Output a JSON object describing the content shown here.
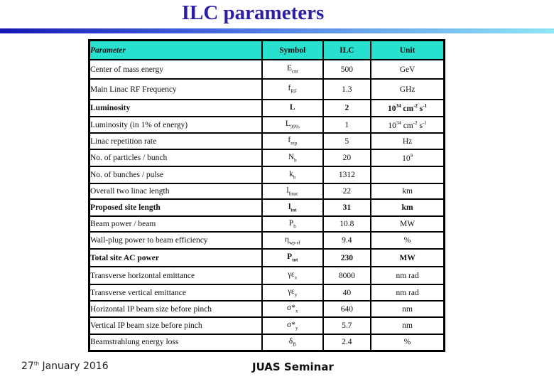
{
  "title": "ILC parameters",
  "table": {
    "headers": {
      "parameter": "Parameter",
      "symbol": "Symbol",
      "ilc": "ILC",
      "unit": "Unit"
    },
    "rows": [
      {
        "parameter": "Center of mass energy",
        "symbol": "E",
        "symbol_sub": "cm",
        "value": "500",
        "unit": "GeV",
        "unit_sup1": "",
        "unit_mid": "",
        "unit_sup2": "",
        "unit_end": "",
        "unit_sup3": "",
        "bold": false
      },
      {
        "parameter": "Main Linac RF Frequency",
        "symbol": "f",
        "symbol_sub": "RF",
        "value": "1.3",
        "unit": "GHz",
        "bold": false
      },
      {
        "parameter": "Luminosity",
        "symbol": "L",
        "symbol_sub": "",
        "value": "2",
        "unit": "10",
        "unit_sup1": "34",
        "unit_mid": " cm",
        "unit_sup2": "-2",
        "unit_end": " s",
        "unit_sup3": "-1",
        "bold": true
      },
      {
        "parameter": "Luminosity (in 1% of energy)",
        "symbol": "L",
        "symbol_sub": "99%",
        "value": "1",
        "unit": "10",
        "unit_sup1": "34",
        "unit_mid": " cm",
        "unit_sup2": "-2",
        "unit_end": " s",
        "unit_sup3": "-1",
        "bold": false
      },
      {
        "parameter": "Linac repetition rate",
        "symbol": "f",
        "symbol_sub": "rep",
        "value": "5",
        "unit": "Hz",
        "bold": false
      },
      {
        "parameter": "No. of particles / bunch",
        "symbol": "N",
        "symbol_sub": "b",
        "value": "20",
        "unit": "10",
        "unit_sup1": "9",
        "bold": false
      },
      {
        "parameter": "No. of bunches / pulse",
        "symbol": "k",
        "symbol_sub": "b",
        "value": "1312",
        "unit": "",
        "bold": false
      },
      {
        "parameter": "Overall two linac length",
        "symbol": "l",
        "symbol_sub": "linac",
        "value": "22",
        "unit": "km",
        "bold": false
      },
      {
        "parameter": "Proposed site length",
        "symbol": "l",
        "symbol_sub": "tot",
        "value": "31",
        "unit": "km",
        "bold": true
      },
      {
        "parameter": "Beam power / beam",
        "symbol": "P",
        "symbol_sub": "b",
        "value": "10.8",
        "unit": "MW",
        "bold": false
      },
      {
        "parameter": "Wall-plug power to beam efficiency",
        "symbol": "η",
        "symbol_sub": "wp-rf",
        "value": "9.4",
        "unit": "%",
        "bold": false
      },
      {
        "parameter": "Total site AC power",
        "symbol": "P",
        "symbol_sub": "tot",
        "value": "230",
        "unit": "MW",
        "bold": true
      },
      {
        "parameter": "Transverse horizontal emittance",
        "symbol": "γε",
        "symbol_sub": "x",
        "value": "8000",
        "unit": "nm rad",
        "bold": false
      },
      {
        "parameter": "Transverse vertical emittance",
        "symbol": "γε",
        "symbol_sub": "y",
        "value": "40",
        "unit": "nm rad",
        "bold": false
      },
      {
        "parameter": "Horizontal IP beam size before pinch",
        "symbol": "σ*",
        "symbol_sub": "x",
        "value": "640",
        "unit": "nm",
        "bold": false
      },
      {
        "parameter": "Vertical IP beam size before pinch",
        "symbol": "σ*",
        "symbol_sub": "y",
        "value": "5.7",
        "unit": "nm",
        "bold": false
      },
      {
        "parameter": "Beamstrahlung energy loss",
        "symbol": "δ",
        "symbol_sub": "B",
        "value": "2.4",
        "unit": "%",
        "bold": false
      }
    ]
  },
  "footer": {
    "date_day": "27",
    "date_suffix": "th",
    "date_rest": " January 2016",
    "center": "JUAS Seminar"
  }
}
